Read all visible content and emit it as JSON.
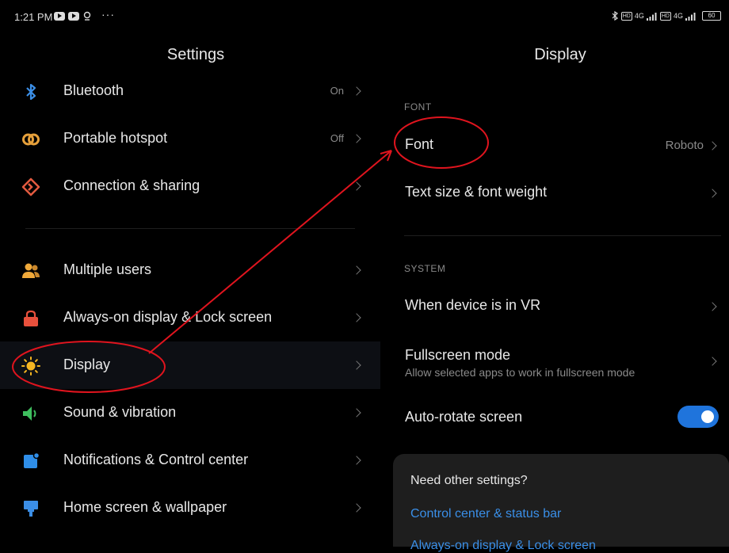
{
  "status_bar": {
    "time": "1:21 PM",
    "dots": "···",
    "network_left": "4G",
    "network_right": "4G",
    "hd_label": "HD",
    "battery": "60"
  },
  "left_panel": {
    "title": "Settings",
    "items": [
      {
        "label": "Bluetooth",
        "value": "On",
        "icon": "bluetooth-icon"
      },
      {
        "label": "Portable hotspot",
        "value": "Off",
        "icon": "hotspot-icon"
      },
      {
        "label": "Connection & sharing",
        "value": "",
        "icon": "connection-sharing-icon"
      },
      {
        "label": "Multiple users",
        "value": "",
        "icon": "users-icon"
      },
      {
        "label": "Always-on display & Lock screen",
        "value": "",
        "icon": "lock-icon"
      },
      {
        "label": "Display",
        "value": "",
        "icon": "sun-icon"
      },
      {
        "label": "Sound & vibration",
        "value": "",
        "icon": "speaker-icon"
      },
      {
        "label": "Notifications & Control center",
        "value": "",
        "icon": "notifications-icon"
      },
      {
        "label": "Home screen & wallpaper",
        "value": "",
        "icon": "brush-icon"
      }
    ]
  },
  "right_panel": {
    "title": "Display",
    "sections": {
      "font": "FONT",
      "system": "SYSTEM"
    },
    "font_row": {
      "label": "Font",
      "value": "Roboto"
    },
    "text_size_row": {
      "label": "Text size & font weight"
    },
    "vr_row": {
      "label": "When device is in VR"
    },
    "fullscreen_row": {
      "label": "Fullscreen mode",
      "subtitle": "Allow selected apps to work in fullscreen mode"
    },
    "autorotate_row": {
      "label": "Auto-rotate screen",
      "enabled": true
    },
    "card": {
      "title": "Need other settings?",
      "links": [
        "Control center & status bar",
        "Always-on display & Lock screen"
      ]
    }
  },
  "colors": {
    "accent": "#1f74dc",
    "link": "#3a8fe8",
    "annotation": "#e0141e",
    "bluetooth": "#3b8ee6",
    "hotspot": "#e6a03b",
    "connection": "#e35a40",
    "users": "#f0a93a",
    "lock": "#e8503c",
    "display": "#f5b622",
    "sound": "#3fbf5f",
    "notifications": "#2f8ee8",
    "homescreen": "#3b8ee6"
  }
}
